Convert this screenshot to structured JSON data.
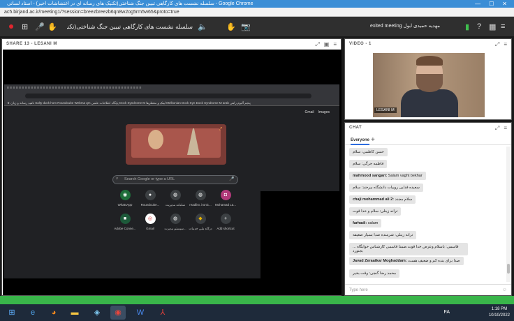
{
  "window": {
    "title": "سلسله نشست های کارگاهی تبیین جنگ شناختی(تکنیک های رسانه ای در اغتشاشات اخیر) - استاد لسانی - Google Chrome",
    "controls": [
      "—",
      "☐",
      "✕"
    ]
  },
  "url": "ac5.birjand.ac.ir/meeting1/?session=breezbreezb6qn8w2og5rm5w65&proto=true",
  "toolbar": {
    "meeting_title": "سلسله نشست های کارگاهی تبیین جنگ شناختی(تکنیک های رسانه ای در اغتشاشات اخیر)",
    "user": "exited meeting مهدیه حمیدی ابول"
  },
  "share": {
    "header": "SHARE 13 - LESANI M"
  },
  "browser": {
    "tabs": "≡ ≡ ≡ ≡ ≡ ≡ ≡ ≡ ≡ ≡ ≡ ≡ ≡ ≡ ≡ ≡ ≡ ≡ ≡ ≡ ≡ ≡ ≡ ≡ ≡ ≡ ≡ ≡ ≡ ≡ ≡ ≡ ≡ ≡ ≡ ≡ ≡ ≡ ≡ ≡ ≡ ≡ ≡ ≡ ≡",
    "bookmarks": "★ ناهید رسانه و زبان   Salty duck hom   Roundcube Webma   qm   پایگاه اطلاعات علمی   Dock Syndrome M   لینک و منتظرها   Melkonian Dock Syn   Dock Syndrome M   arab   پنجم آلبوم راهی",
    "gmail": "Gmail",
    "images": "Images",
    "search_placeholder": "Search Google or type a URL",
    "shortcuts": [
      {
        "label": "WhatsApp",
        "icon": "◉"
      },
      {
        "label": "Roundcube...",
        "icon": "●"
      },
      {
        "label": "سامانه مدیریت",
        "icon": "◍"
      },
      {
        "label": "readlist .ironic...",
        "icon": "◍"
      },
      {
        "label": "Mohamad La...",
        "icon": "◘"
      },
      {
        "label": "Adobe Conne...",
        "icon": "■"
      },
      {
        "label": "Gmail",
        "icon": "◎"
      },
      {
        "label": "سیستم مدیرت...",
        "icon": "◍"
      },
      {
        "label": "درگاه ملی خدمات",
        "icon": "◆"
      },
      {
        "label": "Add shortcut",
        "icon": "+"
      }
    ]
  },
  "video": {
    "header": "VIDEO - 1",
    "name": "LESANI M"
  },
  "chat": {
    "header": "CHAT",
    "tab": "Everyone",
    "plus": "+",
    "messages": [
      {
        "sender": "",
        "text": "حسن کاظمی: سلام"
      },
      {
        "sender": "",
        "text": "فاطمه جرگی: سلام"
      },
      {
        "sender": "mahmood sangari:",
        "text": " Salam vaght bekhar"
      },
      {
        "sender": "",
        "text": "سعیده قدایی روییات دانشگاه بیرجند: سلام"
      },
      {
        "sender": "chaji mohammad ali 2:",
        "text": " سلام مجدد"
      },
      {
        "sender": "",
        "text": "ترانه زینلی: سلام و خدا قوت"
      },
      {
        "sender": "farhadi:",
        "text": " salam"
      },
      {
        "sender": "",
        "text": "ترانه زینلی: شرمنده صدا بسیار ضعیفه"
      },
      {
        "sender": "",
        "text": "قاسمی: باسلام وعرض خدا قوت.ضمنا قاسمی کارشناس خوابگاه ... بجنورد"
      },
      {
        "sender": "Javad Zeraatkar Moghaddam:",
        "text": " صدا برای بنده کم و ضعیف هست"
      },
      {
        "sender": "",
        "text": "محمد رضا گنجی: وقت بخیر"
      }
    ],
    "placeholder": "Type here"
  },
  "taskbar": {
    "lang": "FA",
    "time": "1:18 PM",
    "date": "10/10/2022"
  }
}
